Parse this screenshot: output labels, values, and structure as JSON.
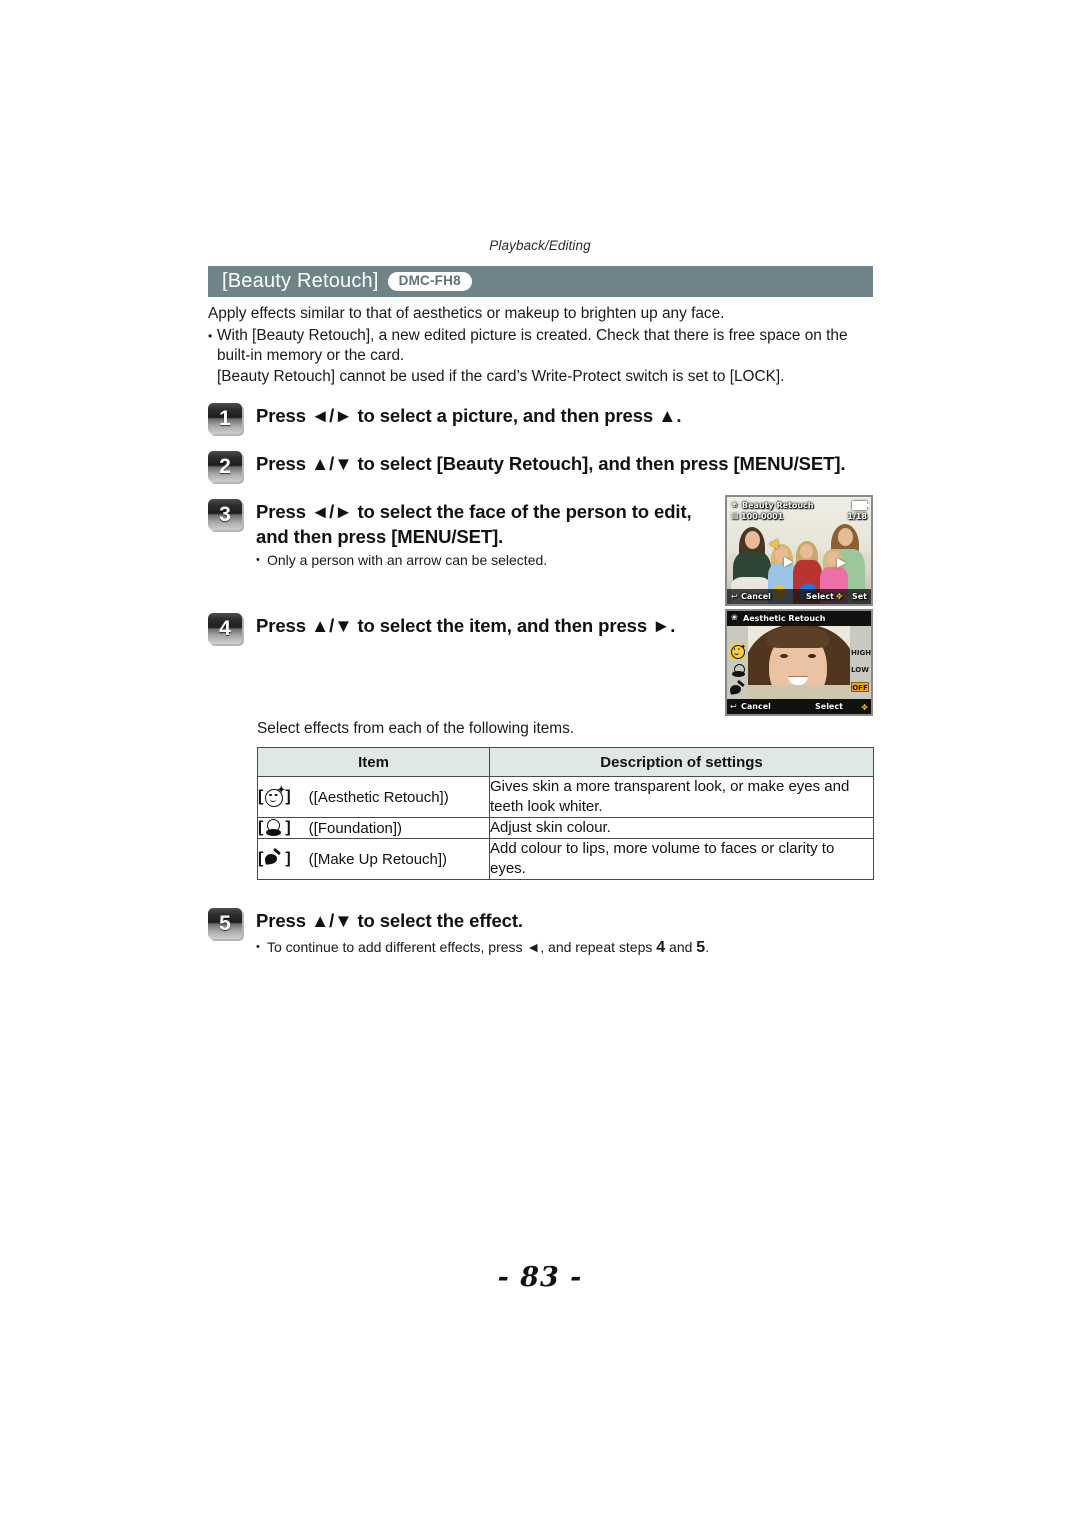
{
  "running_head": "Playback/Editing",
  "section": {
    "title": "[Beauty Retouch]",
    "model_badge": "DMC-FH8"
  },
  "intro": {
    "line1": "Apply effects similar to that of aesthetics or makeup to brighten up any face.",
    "bullet_dot": "•",
    "bullet_line1": "With [Beauty Retouch], a new edited picture is created. Check that there is free space on the built-in memory or the card.",
    "bullet_line2": "[Beauty Retouch] cannot be used if the card’s Write-Protect switch is set to [LOCK]."
  },
  "steps": [
    {
      "num": "1",
      "text": "Press ◄/► to select a picture, and then press ▲."
    },
    {
      "num": "2",
      "text": "Press ▲/▼ to select [Beauty Retouch], and then press [MENU/SET]."
    },
    {
      "num": "3",
      "text": "Press ◄/► to select the face of the person to edit, and then press [MENU/SET]."
    },
    {
      "num": "4",
      "text": "Press ▲/▼ to select the item, and then press ►."
    },
    {
      "num": "5",
      "text": "Press ▲/▼ to select the effect."
    }
  ],
  "step3_note": {
    "dot": "•",
    "text": "Only a person with an arrow can be selected."
  },
  "select_effects_line": "Select effects from each of the following items.",
  "step5_note": {
    "dot": "•",
    "text_a": "To continue to add different effects, press ◄, and repeat steps ",
    "num_a": "4",
    "text_b": " and ",
    "num_b": "5",
    "text_c": "."
  },
  "table": {
    "headers": [
      "Item",
      "Description of settings"
    ],
    "rows": [
      {
        "icon_name": "aesthetic-retouch-icon",
        "bracket_open": "[",
        "bracket_close": "]",
        "label": "([Aesthetic Retouch])",
        "description": "Gives skin a more transparent look, or make eyes and teeth look whiter."
      },
      {
        "icon_name": "foundation-icon",
        "bracket_open": "[",
        "bracket_close": "]",
        "label": "([Foundation])",
        "description": "Adjust skin colour."
      },
      {
        "icon_name": "make-up-retouch-icon",
        "bracket_open": "[",
        "bracket_close": "]",
        "label": "([Make Up Retouch])",
        "description": "Add colour to lips, more volume to faces or clarity to eyes."
      }
    ]
  },
  "camera_screen_1": {
    "name": "beauty-retouch-face-select-screen",
    "title": "Beauty Retouch",
    "file_number": "100-0001",
    "counter": "1/18",
    "cancel_label": "Cancel",
    "select_label": "Select",
    "set_label": "Set"
  },
  "camera_screen_2": {
    "name": "aesthetic-retouch-level-screen",
    "title": "Aesthetic Retouch",
    "options": [
      "HIGH",
      "LOW",
      "OFF"
    ],
    "selected_option": "OFF",
    "cancel_label": "Cancel",
    "select_label": "Select"
  },
  "page_number": "- 83 -",
  "colors": {
    "section_bar": "#6f8488",
    "table_header": "#dfe8e7",
    "badge_text": "#5e7478",
    "highlight_orange": "#f3a32a",
    "highlight_yellow": "#f2cf45"
  }
}
